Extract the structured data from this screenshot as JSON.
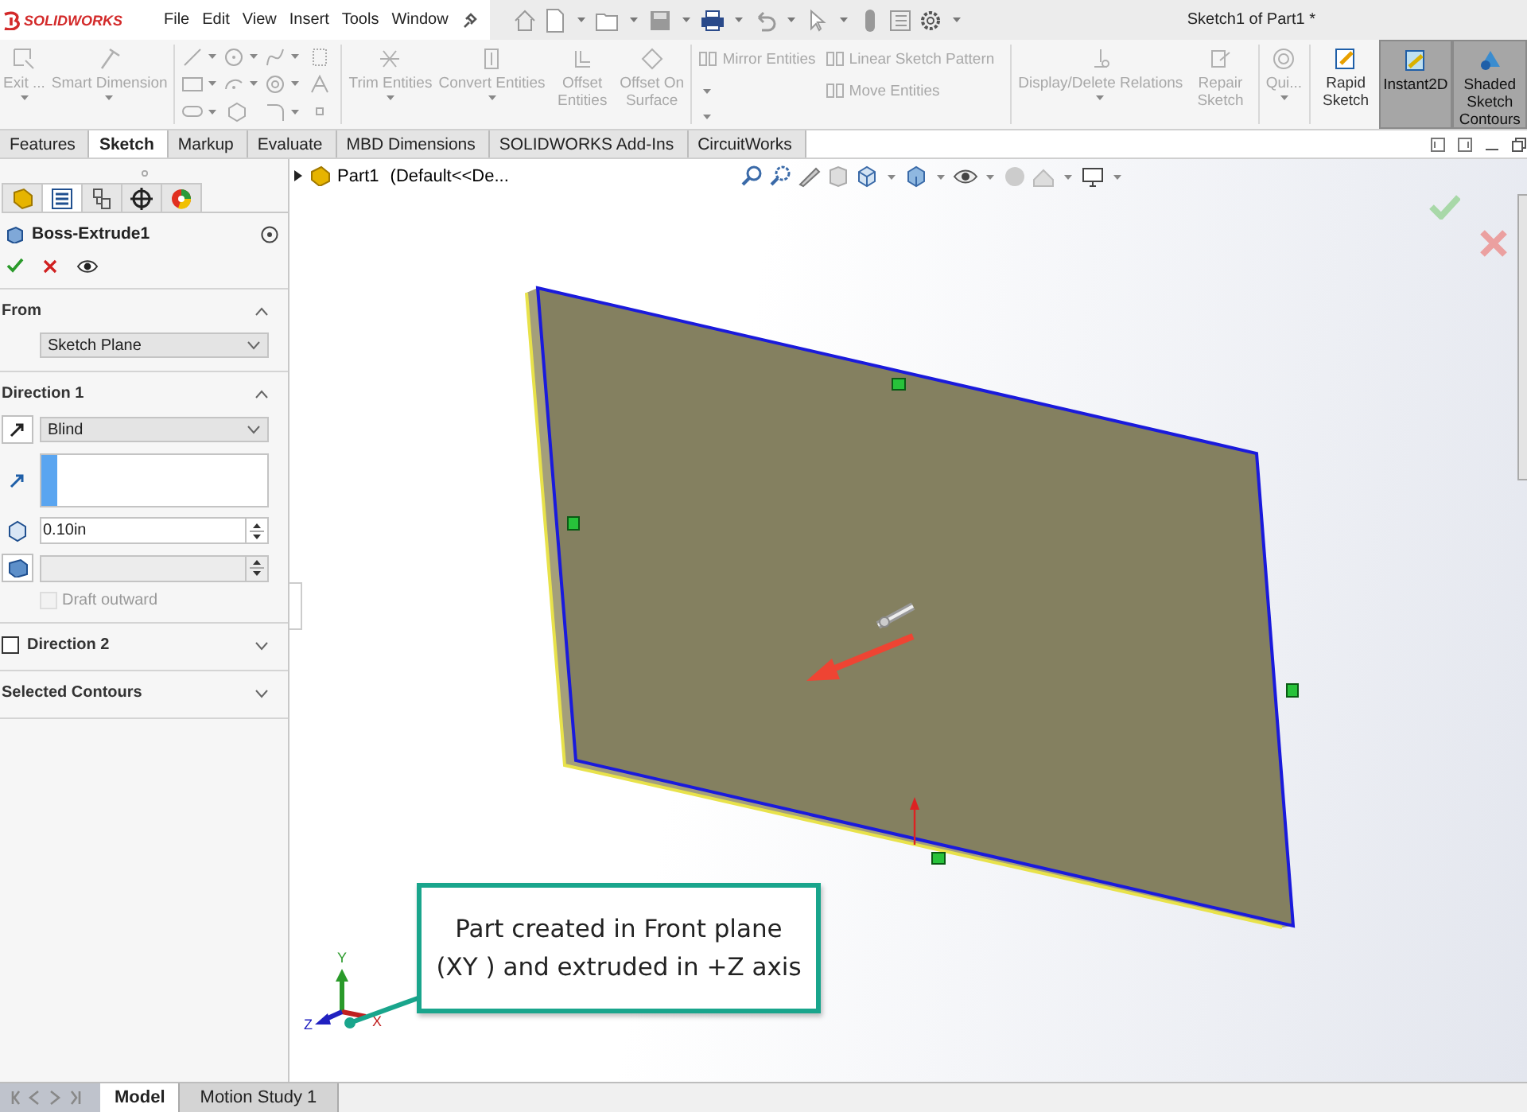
{
  "app": {
    "logo": "SOLIDWORKS",
    "title": "Sketch1 of Part1 *"
  },
  "menu": [
    "File",
    "Edit",
    "View",
    "Insert",
    "Tools",
    "Window"
  ],
  "ribbon": [
    {
      "kind": "large",
      "label": "Exit ...",
      "dropdown": true,
      "disabled": true,
      "pressed": false
    },
    {
      "kind": "large",
      "label": "Smart Dimension",
      "dropdown": true,
      "disabled": true,
      "pressed": false
    },
    {
      "kind": "tools",
      "disabled": true
    },
    {
      "kind": "large",
      "label": "Trim Entities",
      "dropdown": true,
      "disabled": true,
      "pressed": false
    },
    {
      "kind": "large",
      "label": "Convert Entities",
      "dropdown": true,
      "disabled": true,
      "pressed": false
    },
    {
      "kind": "large",
      "label": "Offset Entities",
      "dropdown": false,
      "disabled": true,
      "pressed": false
    },
    {
      "kind": "large",
      "label": "Offset On Surface",
      "dropdown": false,
      "disabled": true,
      "pressed": false
    },
    {
      "kind": "small",
      "label": "Mirror Entities",
      "dropdown": false,
      "disabled": true
    },
    {
      "kind": "small",
      "label": "Linear Sketch Pattern",
      "dropdown": true,
      "disabled": true
    },
    {
      "kind": "small",
      "label": "Move Entities",
      "dropdown": true,
      "disabled": true
    },
    {
      "kind": "large",
      "label": "Display/Delete Relations",
      "dropdown": true,
      "disabled": true,
      "pressed": false
    },
    {
      "kind": "large",
      "label": "Repair Sketch",
      "dropdown": false,
      "disabled": true,
      "pressed": false
    },
    {
      "kind": "large",
      "label": "Qui...",
      "dropdown": true,
      "disabled": true,
      "pressed": false
    },
    {
      "kind": "large",
      "label": "Rapid Sketch",
      "dropdown": false,
      "disabled": false,
      "pressed": false
    },
    {
      "kind": "large",
      "label": "Instant2D",
      "dropdown": false,
      "disabled": false,
      "pressed": true
    },
    {
      "kind": "large",
      "label": "Shaded Sketch Contours",
      "dropdown": false,
      "disabled": false,
      "pressed": true
    }
  ],
  "command_tabs": [
    {
      "label": "Features",
      "selected": false
    },
    {
      "label": "Sketch",
      "selected": true
    },
    {
      "label": "Markup",
      "selected": false
    },
    {
      "label": "Evaluate",
      "selected": false
    },
    {
      "label": "MBD Dimensions",
      "selected": false
    },
    {
      "label": "SOLIDWORKS Add-Ins",
      "selected": false
    },
    {
      "label": "CircuitWorks",
      "selected": false
    }
  ],
  "property_manager": {
    "panel_tabs": [
      {
        "selected": false
      },
      {
        "selected": true
      },
      {
        "selected": false
      },
      {
        "selected": false
      },
      {
        "selected": false
      }
    ],
    "title": "Boss-Extrude1",
    "sections": [
      {
        "kind": "from",
        "title": "From",
        "expanded": true,
        "start": "Sketch Plane"
      },
      {
        "kind": "direction",
        "title": "Direction 1",
        "expanded": true,
        "end_condition": "Blind",
        "depth": "0.10in",
        "draft": {
          "label": "Draft outward",
          "checked": false,
          "disabled": true
        }
      },
      {
        "kind": "toggle",
        "title": "Direction 2",
        "checked": false,
        "expanded": false
      },
      {
        "kind": "plain",
        "title": "Selected Contours",
        "expanded": false
      }
    ]
  },
  "viewport": {
    "tree": {
      "name": "Part1",
      "config": "(Default<<De..."
    },
    "callout": {
      "lines": [
        "Part created in Front plane",
        "(XY ) and extruded in +Z axis"
      ]
    },
    "triad": {
      "x": "X",
      "y": "Y",
      "z": "Z"
    }
  },
  "bottom_tabs": [
    {
      "label": "Model",
      "selected": true
    },
    {
      "label": "Motion Study 1",
      "selected": false
    }
  ]
}
